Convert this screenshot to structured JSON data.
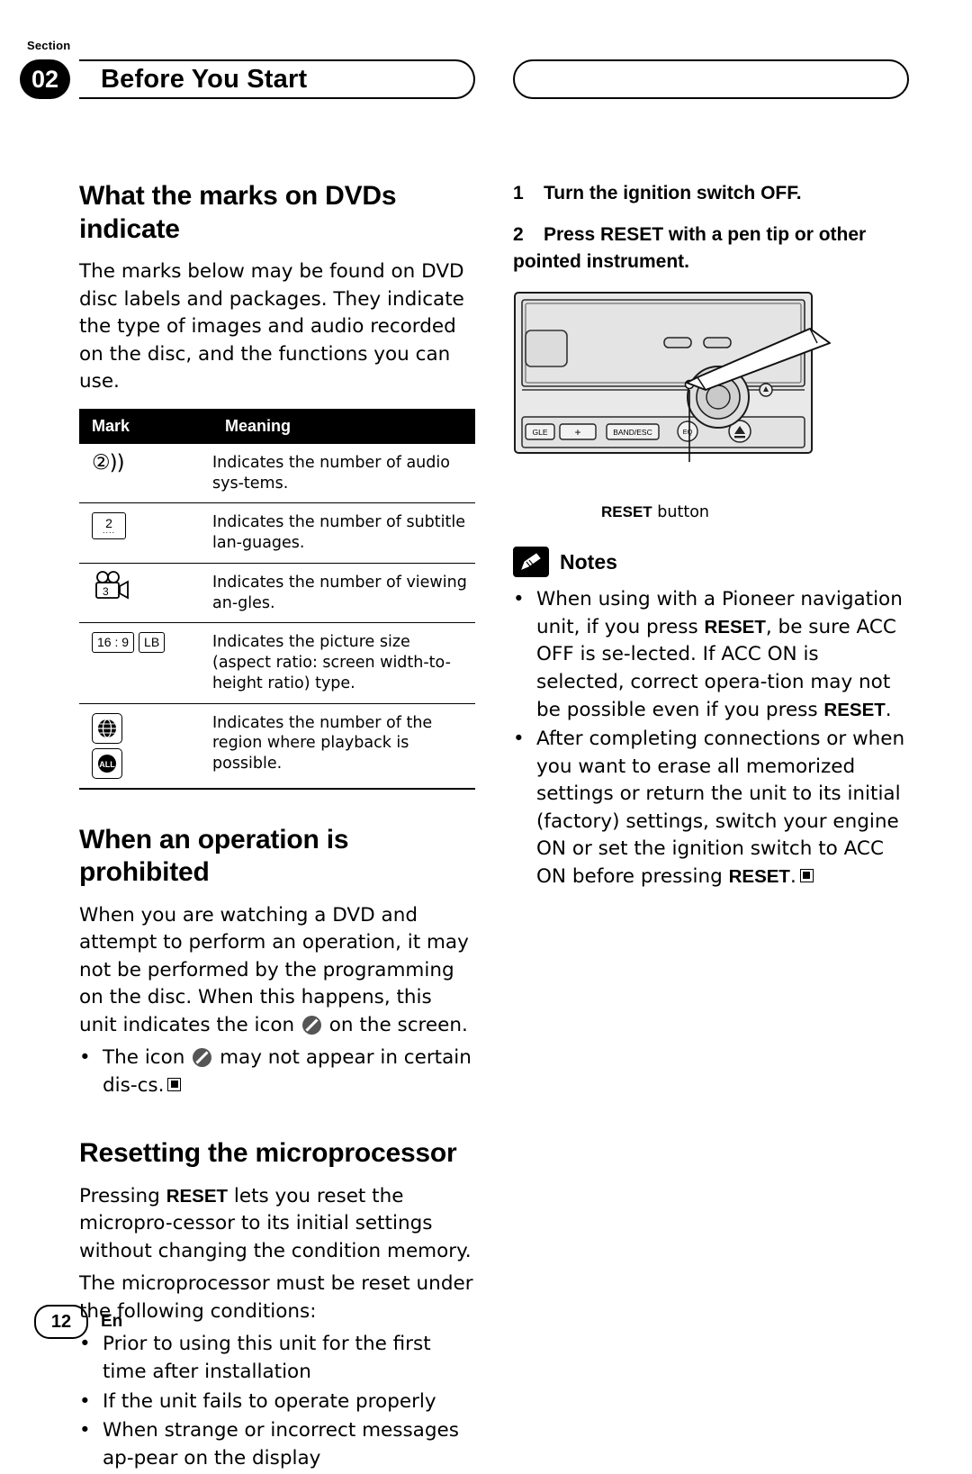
{
  "header": {
    "section_label": "Section",
    "section_number": "02",
    "title": "Before You Start"
  },
  "left_column": {
    "heading1": "What the marks on DVDs indicate",
    "intro": "The marks below may be found on DVD disc labels and packages. They indicate the type of images and audio recorded on the disc, and the functions you can use.",
    "table": {
      "columns": [
        "Mark",
        "Meaning"
      ],
      "rows": [
        {
          "icon": "audio-systems-icon",
          "icon_text": "2",
          "meaning": "Indicates the number of audio sys-tems."
        },
        {
          "icon": "subtitle-languages-icon",
          "icon_text": "2",
          "meaning": "Indicates the number of subtitle lan-guages."
        },
        {
          "icon": "viewing-angles-icon",
          "icon_text": "3",
          "meaning": "Indicates the number of viewing an-gles."
        },
        {
          "icon": "aspect-ratio-icon",
          "icon_text": "16 : 9",
          "icon_text2": "LB",
          "meaning": "Indicates the picture size (aspect ratio: screen width-to-height ratio) type."
        },
        {
          "icon": "region-code-icon",
          "icon_text": "ALL",
          "meaning": "Indicates the number of the region where playback is possible."
        }
      ]
    },
    "heading2": "When an operation is prohibited",
    "prohibited_text_a": "When you are watching a DVD and attempt to perform an operation, it may not be performed by the programming on the disc. When this happens, this unit indicates the icon",
    "prohibited_text_b": "on the screen.",
    "prohibited_bullet_a": "The icon",
    "prohibited_bullet_b": "may not appear in certain dis-cs.",
    "heading3": "Resetting the microprocessor",
    "reset_para1_a": "Pressing",
    "reset_para1_bold": "RESET",
    "reset_para1_b": "lets you reset the micropro-cessor to its initial settings without changing the condition memory.",
    "reset_para2": "The microprocessor must be reset under the following conditions:",
    "reset_bullets": [
      "Prior to using this unit for the first time after installation",
      "If the unit fails to operate properly",
      "When strange or incorrect messages ap-pear on the display"
    ]
  },
  "right_column": {
    "step1_num": "1",
    "step1": "Turn the ignition switch OFF.",
    "step2_num": "2",
    "step2": "Press RESET with a pen tip or other pointed instrument.",
    "unit_labels": {
      "angle": "GLE",
      "band": "BAND/ESC",
      "eq": "EQ",
      "plus": "+"
    },
    "reset_caption_bold": "RESET",
    "reset_caption_rest": "button",
    "notes_title": "Notes",
    "note1_a": "When using with a Pioneer navigation unit, if you press",
    "note1_bold1": "RESET",
    "note1_b": ", be sure ACC OFF is se-lected. If ACC ON is selected, correct opera-tion may not be possible even if you press",
    "note1_bold2": "RESET",
    "note1_c": ".",
    "note2_a": "After completing connections or when you want to erase all memorized settings or return the unit to its initial (factory) settings, switch your engine ON or set the ignition switch to ACC ON before pressing",
    "note2_bold": "RESET",
    "note2_b": "."
  },
  "footer": {
    "page_number": "12",
    "language": "En"
  },
  "colors": {
    "ink": "#000000",
    "paper": "#ffffff",
    "unit_body": "#e8e8e8",
    "unit_dark": "#cfcfcf"
  }
}
